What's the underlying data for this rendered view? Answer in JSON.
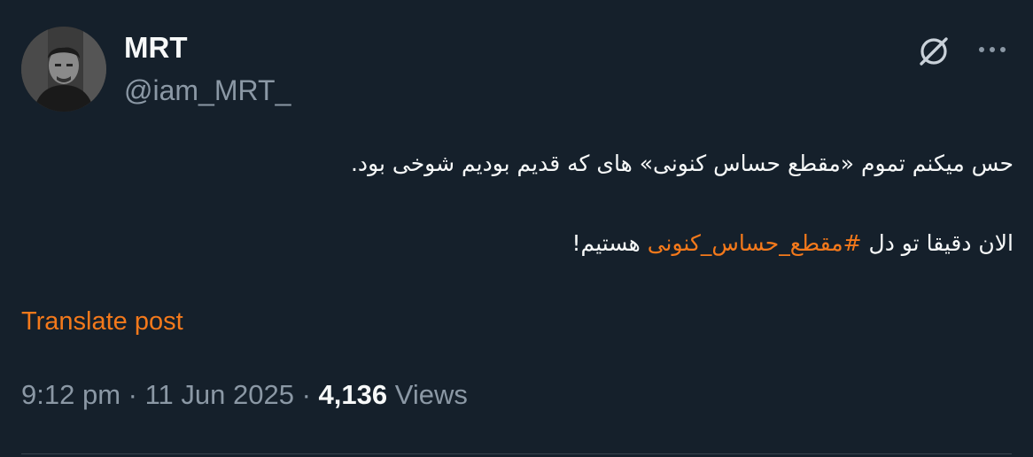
{
  "author": {
    "display_name": "MRT",
    "handle": "@iam_MRT_"
  },
  "icons": {
    "grok": "grok-icon",
    "more": "more-icon"
  },
  "tweet": {
    "line1": "حس میکنم تموم «مقطع حساس کنونی» های که قدیم بودیم شوخی بود.",
    "line2_before": "الان دقیقا تو دل ",
    "hashtag": "#مقطع_حساس_کنونی",
    "line2_after": " هستیم!"
  },
  "translate_label": "Translate post",
  "meta": {
    "time": "9:12 pm",
    "separator": "·",
    "date": "11 Jun 2025",
    "views_count": "4,136",
    "views_label": "Views"
  },
  "colors": {
    "background": "#15202b",
    "accent": "#f4791b",
    "secondary_text": "#8b98a5",
    "primary_text": "#f7f9f9"
  }
}
